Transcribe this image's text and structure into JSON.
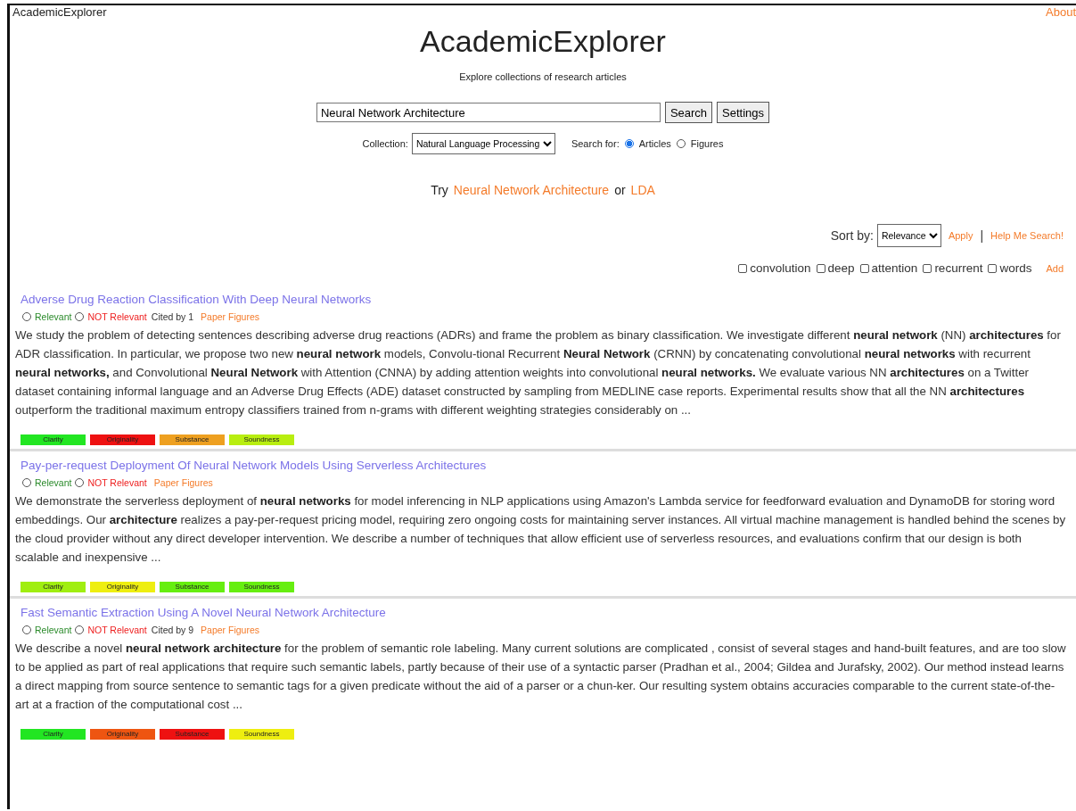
{
  "top_bar": {
    "brand": "AcademicExplorer",
    "about": "About"
  },
  "header": {
    "title": "AcademicExplorer",
    "subtitle": "Explore collections of research articles"
  },
  "search": {
    "value": "Neural Network Architecture",
    "search_button": "Search",
    "settings_button": "Settings"
  },
  "options": {
    "collection_label": "Collection:",
    "collection": "Natural Language Processing",
    "search_for_label": "Search for:",
    "search_for": [
      {
        "label": "Articles",
        "selected": true
      },
      {
        "label": "Figures",
        "selected": false
      }
    ]
  },
  "suggestions": {
    "lead": "Try",
    "joiner": "or",
    "links": [
      "Neural Network Architecture",
      "LDA"
    ]
  },
  "sort": {
    "label": "Sort by:",
    "value": "Relevance",
    "apply": "Apply",
    "separator": "|",
    "help": "Help Me Search!"
  },
  "keywords": {
    "items": [
      {
        "label": "convolution",
        "checked": false
      },
      {
        "label": "deep",
        "checked": false
      },
      {
        "label": "attention",
        "checked": false
      },
      {
        "label": "recurrent",
        "checked": false
      },
      {
        "label": "words",
        "checked": false
      }
    ],
    "add": "Add"
  },
  "results": [
    {
      "title": "Adverse Drug Reaction Classification With Deep Neural Networks",
      "relevance": [
        {
          "label": "Relevant",
          "kind": "relevant",
          "selected": false
        },
        {
          "label": "NOT Relevant",
          "kind": "not_relevant",
          "selected": false
        }
      ],
      "cited_by": "Cited by 1",
      "figures_link": "Paper Figures",
      "abstract": "We study the problem of detecting sentences describing adverse drug reactions (ADRs) and frame the problem as binary classification. We investigate different **neural network** (NN) **architectures** for ADR classification. In particular, we propose two new **neural network** models, Convolu-tional Recurrent **Neural Network** (CRNN) by concatenating convolutional **neural networks** with recurrent **neural networks,** and Convolutional **Neural Network** with Attention (CNNA) by adding attention weights into convolutional **neural networks.** We evaluate various NN **architectures** on a Twitter dataset containing informal language and an Adverse Drug Effects (ADE) dataset constructed by sampling from MEDLINE case reports. Experimental results show that all the NN **architectures** outperform the traditional maximum entropy classifiers trained from n-grams with different weighting strategies considerably on ...",
      "scores": [
        {
          "label": "Clarity",
          "color": "#22e622"
        },
        {
          "label": "Originality",
          "color": "#ee1111"
        },
        {
          "label": "Substance",
          "color": "#eea020"
        },
        {
          "label": "Soundness",
          "color": "#b8ee10"
        }
      ]
    },
    {
      "title": "Pay-per-request Deployment Of Neural Network Models Using Serverless Architectures",
      "relevance": [
        {
          "label": "Relevant",
          "kind": "relevant",
          "selected": false
        },
        {
          "label": "NOT Relevant",
          "kind": "not_relevant",
          "selected": false
        }
      ],
      "figures_link": "Paper Figures",
      "abstract": "We demonstrate the serverless deployment of **neural networks** for model inferencing in NLP applications using Amazon's Lambda service for feedforward evaluation and DynamoDB for storing word embeddings. Our **architecture** realizes a pay-per-request pricing model, requiring zero ongoing costs for maintaining server instances. All virtual machine management is handled behind the scenes by the cloud provider without any direct developer intervention. We describe a number of techniques that allow efficient use of serverless resources, and evaluations confirm that our design is both scalable and inexpensive ...",
      "scores": [
        {
          "label": "Clarity",
          "color": "#a0ee10"
        },
        {
          "label": "Originality",
          "color": "#eeee10"
        },
        {
          "label": "Substance",
          "color": "#66ee10"
        },
        {
          "label": "Soundness",
          "color": "#66ee10"
        }
      ]
    },
    {
      "title": "Fast Semantic Extraction Using A Novel Neural Network Architecture",
      "relevance": [
        {
          "label": "Relevant",
          "kind": "relevant",
          "selected": false
        },
        {
          "label": "NOT Relevant",
          "kind": "not_relevant",
          "selected": false
        }
      ],
      "cited_by": "Cited by 9",
      "figures_link": "Paper Figures",
      "abstract": "We describe a novel **neural network architecture** for the problem of semantic role labeling. Many current solutions are complicated , consist of several stages and hand-built features, and are too slow to be applied as part of real applications that require such semantic labels, partly because of their use of a syntactic parser (Pradhan et al., 2004; Gildea and Jurafsky, 2002). Our method instead learns a direct mapping from source sentence to semantic tags for a given predicate without the aid of a parser or a chun-ker. Our resulting system obtains accuracies comparable to the current state-of-the-art at a fraction of the computational cost ...",
      "scores": [
        {
          "label": "Clarity",
          "color": "#22e622"
        },
        {
          "label": "Originality",
          "color": "#ee5511"
        },
        {
          "label": "Substance",
          "color": "#ee1111"
        },
        {
          "label": "Soundness",
          "color": "#eeee10"
        }
      ]
    }
  ]
}
